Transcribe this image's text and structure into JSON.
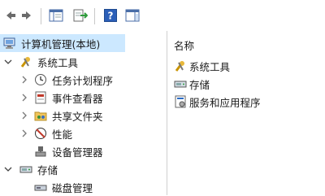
{
  "tree": {
    "root_label": "计算机管理(本地)",
    "system_tools_label": "系统工具",
    "task_scheduler_label": "任务计划程序",
    "event_viewer_label": "事件查看器",
    "shared_folders_label": "共享文件夹",
    "performance_label": "性能",
    "device_manager_label": "设备管理器",
    "storage_label": "存储",
    "disk_management_label": "磁盘管理"
  },
  "list": {
    "header_name": "名称",
    "items": [
      "系统工具",
      "存储",
      "服务和应用程序"
    ]
  },
  "colors": {
    "selection": "#cce8ff",
    "accent_blue": "#2b6cc4"
  },
  "icons": {
    "back": "back-arrow-icon",
    "forward": "forward-arrow-icon",
    "console_tree": "console-tree-icon",
    "export_list": "export-list-icon",
    "help": "help-icon",
    "show_pane": "show-action-pane-icon"
  }
}
